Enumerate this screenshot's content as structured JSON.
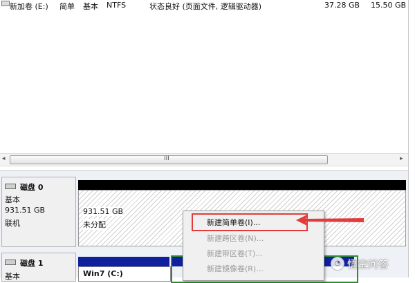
{
  "volume_row": {
    "name": "新加卷 (E:)",
    "layout": "简单",
    "type": "基本",
    "fs": "NTFS",
    "status": "状态良好 (页面文件, 逻辑驱动器)",
    "capacity": "37.28 GB",
    "free": "15.50 GB"
  },
  "scrollbar": {
    "left_arrow": "◂",
    "right_arrow": "▸",
    "grip": "III"
  },
  "disk0": {
    "name": "磁盘 0",
    "type": "基本",
    "size": "931.51 GB",
    "status": "联机",
    "unallocated_size": "931.51 GB",
    "unallocated_label": "未分配"
  },
  "context_menu": {
    "items": [
      {
        "label": "新建简单卷(I)..."
      },
      {
        "label": "新建跨区卷(N)..."
      },
      {
        "label": "新建带区卷(T)..."
      },
      {
        "label": "新建镜像卷(R)..."
      }
    ]
  },
  "disk1": {
    "name": "磁盘 1",
    "type": "基本",
    "partition_label": "Win7 (C:)"
  },
  "watermark": {
    "text": "悟空问答"
  },
  "colors": {
    "highlight": "#e23b3b",
    "partition_bar": "#0f1f9e",
    "selected_border": "#2e8b2e"
  }
}
